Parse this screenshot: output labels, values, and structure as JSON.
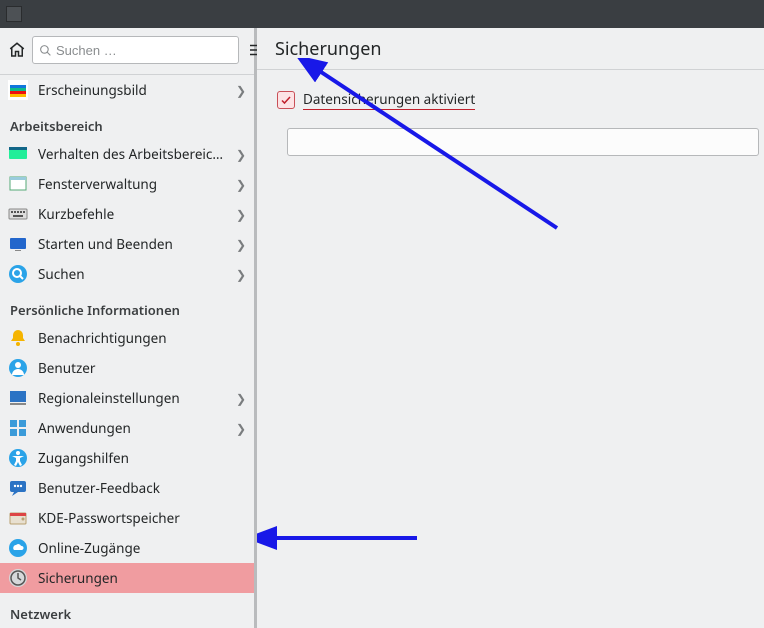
{
  "titlebar": {},
  "search": {
    "placeholder": "Suchen …"
  },
  "appearance_label": "Erscheinungsbild",
  "categories": {
    "workspace": "Arbeitsbereich",
    "personal": "Persönliche Informationen",
    "network": "Netzwerk"
  },
  "items": {
    "workspace_behavior": "Verhalten des Arbeitsbereic…",
    "window_mgmt": "Fensterverwaltung",
    "shortcuts": "Kurzbefehle",
    "startup": "Starten und Beenden",
    "search": "Suchen",
    "notifications": "Benachrichtigungen",
    "users": "Benutzer",
    "regional": "Regionaleinstellungen",
    "applications": "Anwendungen",
    "accessibility": "Zugangshilfen",
    "feedback": "Benutzer-Feedback",
    "kwallet": "KDE-Passwortspeicher",
    "online_accounts": "Online-Zugänge",
    "backups": "Sicherungen"
  },
  "content": {
    "title": "Sicherungen",
    "checkbox_label": "Datensicherungen aktiviert"
  }
}
